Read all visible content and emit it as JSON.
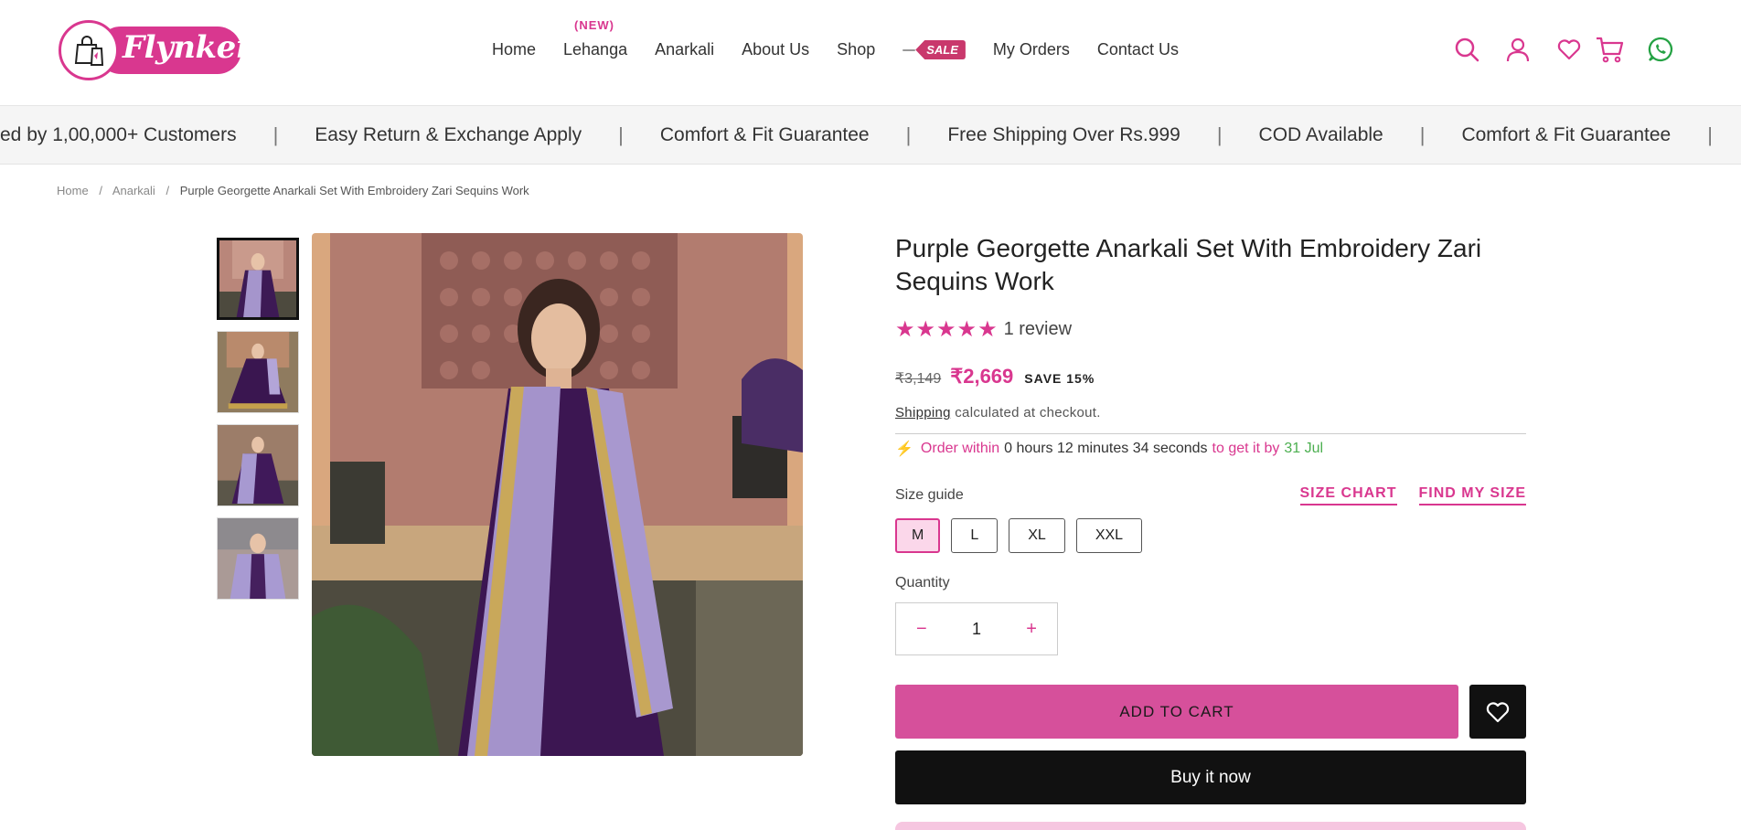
{
  "brand": {
    "name": "Flynker"
  },
  "nav": {
    "items": [
      "Home",
      "Lehanga",
      "Anarkali",
      "About Us",
      "Shop"
    ],
    "new_badge": "(NEW)",
    "sale_label": "SALE",
    "items_after": [
      "My Orders",
      "Contact Us"
    ]
  },
  "header_icons": [
    "search-icon",
    "account-icon",
    "wishlist-heart-icon",
    "cart-icon",
    "whatsapp-icon"
  ],
  "marquee": {
    "messages": [
      "ed by 1,00,000+ Customers",
      "Easy Return & Exchange Apply",
      "Comfort & Fit Guarantee",
      "Free Shipping Over Rs.999",
      "COD Available",
      "Comfort & Fit Guarantee"
    ],
    "separator": "|"
  },
  "breadcrumb": {
    "home": "Home",
    "category": "Anarkali",
    "current": "Purple Georgette Anarkali Set With Embroidery Zari Sequins Work",
    "separator": "/"
  },
  "product": {
    "title": "Purple Georgette Anarkali Set With Embroidery Zari Sequins Work",
    "stars": "★★★★★",
    "rating_count": 5,
    "reviews": "1 review",
    "old_price": "₹3,149",
    "price": "₹2,669",
    "save": "SAVE 15%",
    "shipping_link": "Shipping",
    "shipping_text": "calculated at checkout.",
    "order_prefix": "Order within",
    "order_time": "0 hours 12 minutes 34 seconds",
    "order_mid": "to get it by",
    "order_date": "31 Jul",
    "size_guide": "Size guide",
    "size_chart": "SIZE CHART",
    "find_size": "FIND MY SIZE",
    "sizes": [
      "M",
      "L",
      "XL",
      "XXL"
    ],
    "selected_size": "M",
    "quantity_label": "Quantity",
    "quantity": "1",
    "minus": "−",
    "plus": "+",
    "add_to_cart": "ADD TO CART",
    "buy_now": "Buy it now"
  },
  "colors": {
    "accent": "#d9378f",
    "button_pink": "#d6509b",
    "dark": "#111111",
    "green": "#4caf50"
  }
}
